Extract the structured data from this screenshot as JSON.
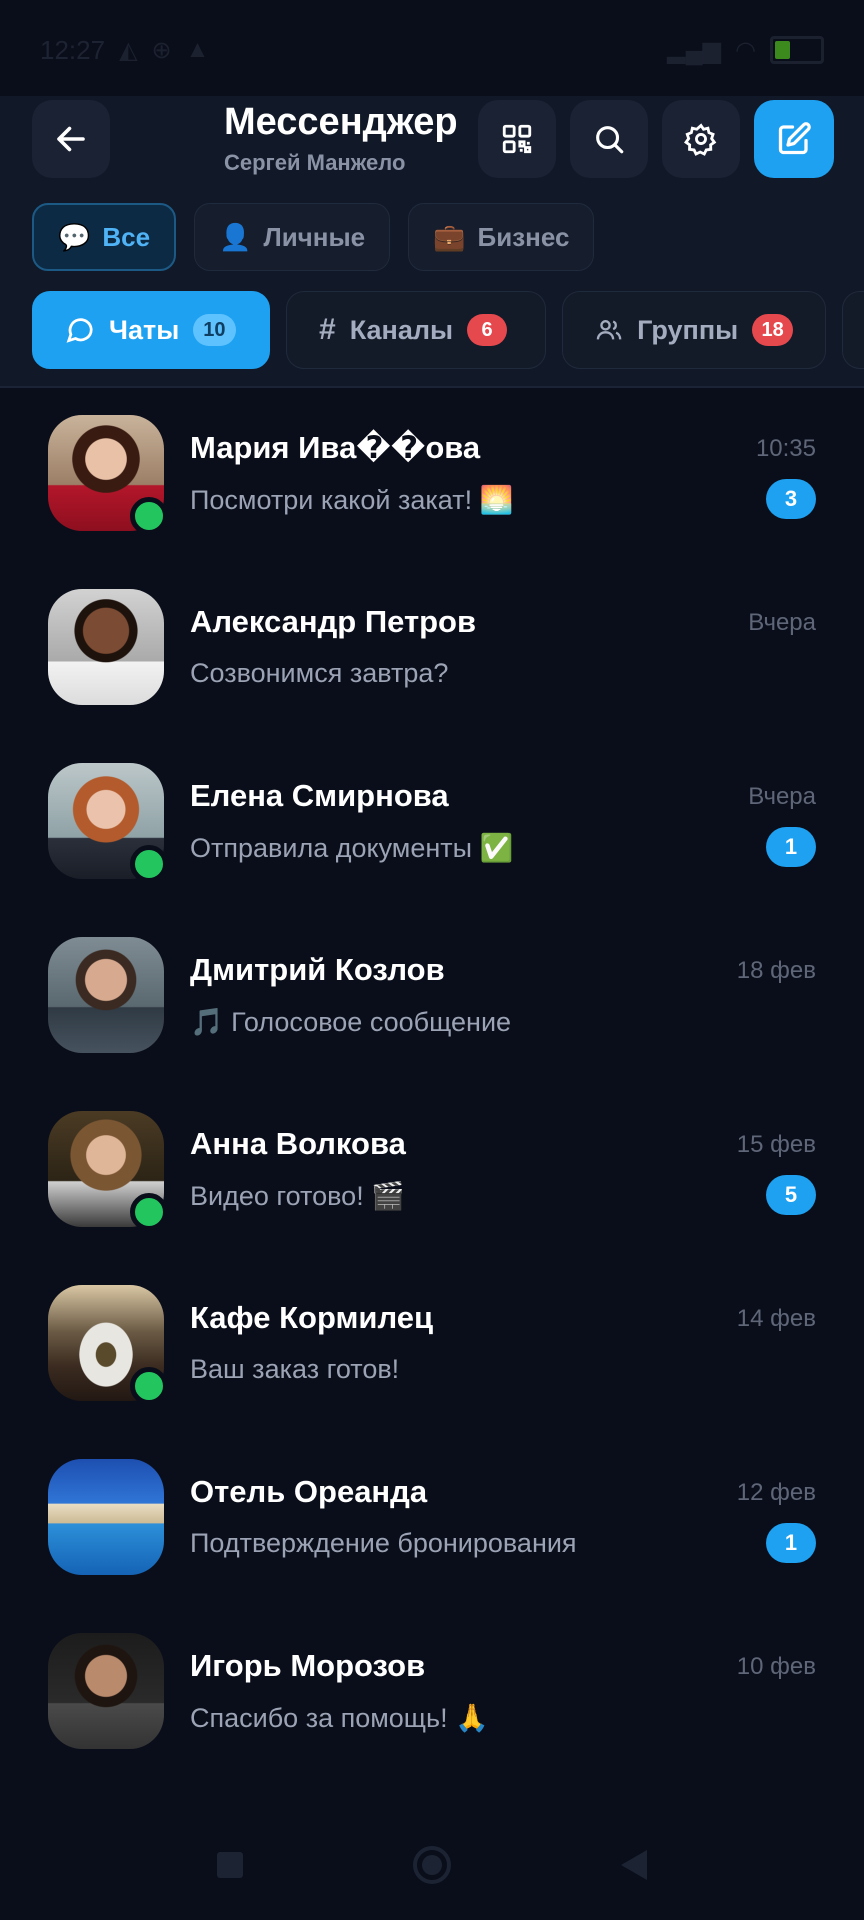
{
  "status_bar": {
    "time": "12:27",
    "battery_level": "5",
    "icons": [
      "vpn-icon",
      "globe-icon",
      "warning-icon",
      "signal-icon",
      "wifi-icon",
      "battery-icon"
    ]
  },
  "header": {
    "title": "Мессенджер",
    "subtitle": "Сергей Манжело",
    "buttons": [
      "back-icon",
      "qr-code-icon",
      "search-icon",
      "settings-icon",
      "compose-icon"
    ],
    "accent_color": "#1ea1f1"
  },
  "filters": [
    {
      "label": "Все",
      "icon": "chat-bubble-icon",
      "active": true
    },
    {
      "label": "Личные",
      "icon": "person-icon",
      "active": false
    },
    {
      "label": "Бизнес",
      "icon": "briefcase-icon",
      "active": false
    }
  ],
  "tabs": [
    {
      "label": "Чаты",
      "count": "10",
      "icon": "chat-icon",
      "active": true
    },
    {
      "label": "Каналы",
      "count": "6",
      "icon": "hash-icon",
      "active": false
    },
    {
      "label": "Группы",
      "count": "18",
      "icon": "group-icon",
      "active": false
    }
  ],
  "chats": [
    {
      "name": "Мария Ива��ова",
      "preview": "Посмотри какой закат! 🌅",
      "time": "10:35",
      "unread": "3",
      "online": true
    },
    {
      "name": "Александр Петров",
      "preview": "Созвонимся завтра?",
      "time": "Вчера",
      "unread": "",
      "online": false
    },
    {
      "name": "Елена Смирнова",
      "preview": "Отправила документы ✅",
      "time": "Вчера",
      "unread": "1",
      "online": true
    },
    {
      "name": "Дмитрий Козлов",
      "preview": "🎵 Голосовое сообщение",
      "time": "18 фев",
      "unread": "",
      "online": false
    },
    {
      "name": "Анна Волкова",
      "preview": "Видео готово! 🎬",
      "time": "15 фев",
      "unread": "5",
      "online": true
    },
    {
      "name": "Кафе Кормилец",
      "preview": "Ваш заказ готов!",
      "time": "14 фев",
      "unread": "",
      "online": true
    },
    {
      "name": "Отель Ореанда",
      "preview": "Подтверждение бронирования",
      "time": "12 фев",
      "unread": "1",
      "online": false
    },
    {
      "name": "Игорь Морозов",
      "preview": "Спасибо за помощь! 🙏",
      "time": "10 фев",
      "unread": "",
      "online": false
    }
  ]
}
